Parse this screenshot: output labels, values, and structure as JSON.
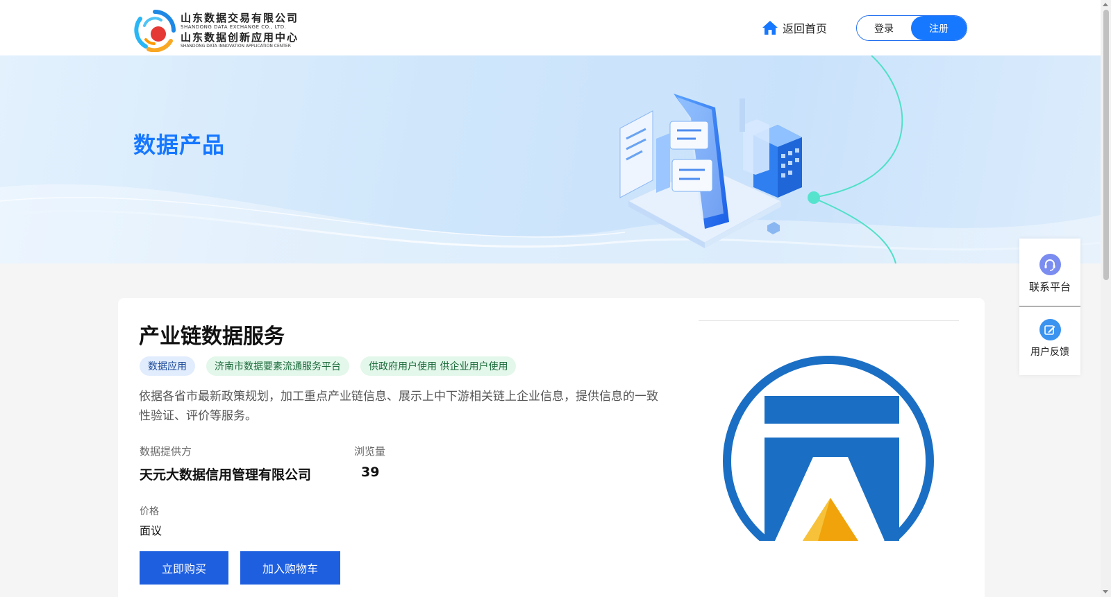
{
  "header": {
    "logo": {
      "cn_line1": "山东数据交易有限公司",
      "en_line1": "SHANDONG DATA EXCHANGE CO., LTD.",
      "cn_line2": "山东数据创新应用中心",
      "en_line2": "SHANDONG DATA INNOVATION APPLICATION CENTER"
    },
    "home_label": "返回首页",
    "login_label": "登录",
    "register_label": "注册"
  },
  "banner": {
    "title": "数据产品"
  },
  "product": {
    "title": "产业链数据服务",
    "tags": [
      {
        "label": "数据应用",
        "style": "blue"
      },
      {
        "label": "济南市数据要素流通服务平台",
        "style": "green"
      },
      {
        "label": "供政府用户使用 供企业用户使用",
        "style": "green"
      }
    ],
    "description": "依据各省市最新政策规划，加工重点产业链信息、展示上中下游相关链上企业信息，提供信息的一致性验证、评价等服务。",
    "provider_label": "数据提供方",
    "provider_value": "天元大数据信用管理有限公司",
    "views_label": "浏览量",
    "views_value": "39",
    "price_label": "价格",
    "price_value": "面议",
    "buy_label": "立即购买",
    "cart_label": "加入购物车"
  },
  "float_panel": {
    "contact_label": "联系平台",
    "feedback_label": "用户反馈"
  },
  "colors": {
    "accent": "#1677ff",
    "button": "#1e5fe0",
    "tag_blue_bg": "#e1ecfd",
    "tag_green_bg": "#e3f7ea",
    "logo_blue": "#1a6fc4",
    "logo_gold": "#f0a30a"
  }
}
